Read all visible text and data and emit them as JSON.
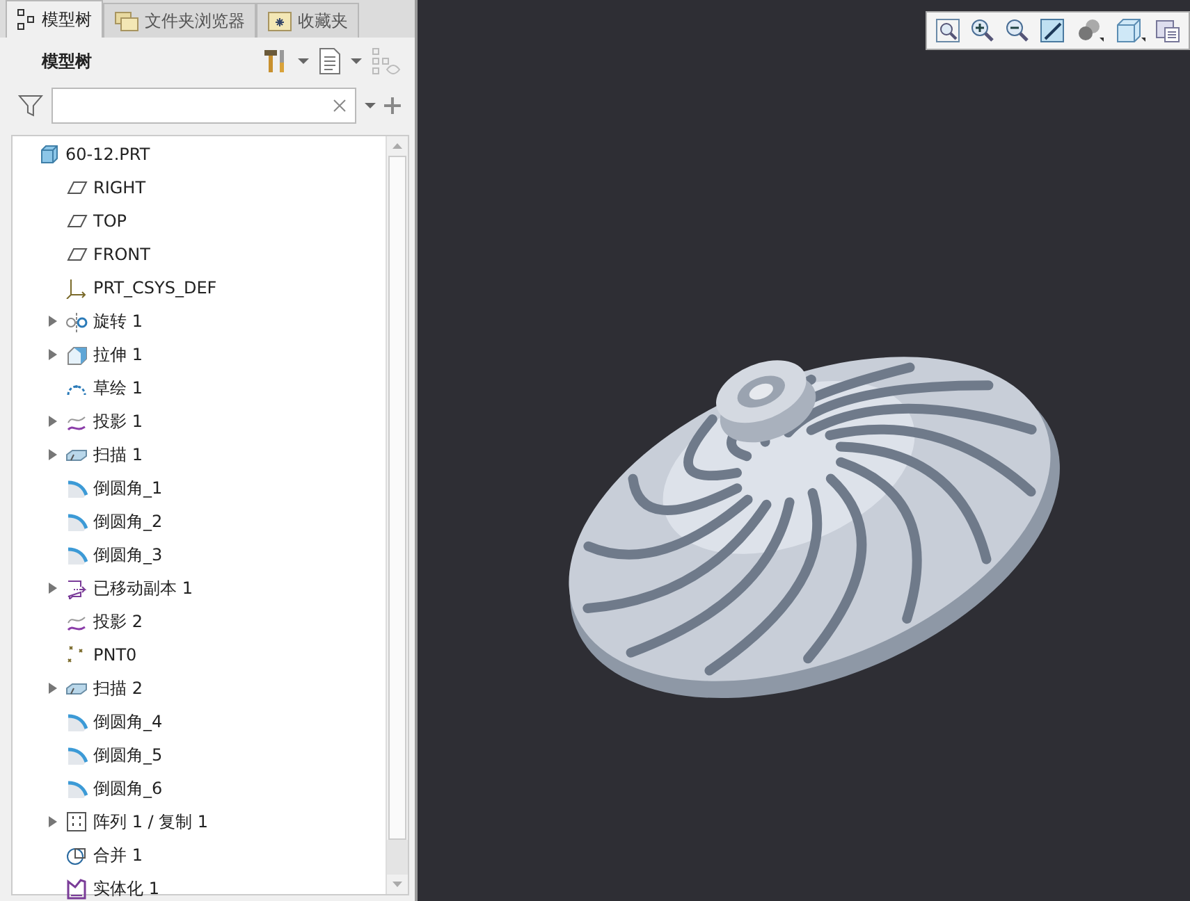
{
  "tabs": [
    {
      "label": "模型树",
      "kind": "tree",
      "selected": true
    },
    {
      "label": "文件夹浏览器",
      "kind": "folders",
      "selected": false
    },
    {
      "label": "收藏夹",
      "kind": "favorites",
      "selected": false
    }
  ],
  "panel_title": "模型树",
  "tree": {
    "label": "60-12.PRT",
    "kind": "part",
    "children": [
      {
        "label": "RIGHT",
        "kind": "plane",
        "expandable": false
      },
      {
        "label": "TOP",
        "kind": "plane",
        "expandable": false
      },
      {
        "label": "FRONT",
        "kind": "plane",
        "expandable": false
      },
      {
        "label": "PRT_CSYS_DEF",
        "kind": "csys",
        "expandable": false
      },
      {
        "label": "旋转 1",
        "kind": "revolve",
        "expandable": true
      },
      {
        "label": "拉伸 1",
        "kind": "extrude",
        "expandable": true
      },
      {
        "label": "草绘 1",
        "kind": "sketch",
        "expandable": false
      },
      {
        "label": "投影 1",
        "kind": "project",
        "expandable": true
      },
      {
        "label": "扫描 1",
        "kind": "sweep",
        "expandable": true
      },
      {
        "label": "倒圆角_1",
        "kind": "round",
        "expandable": false
      },
      {
        "label": "倒圆角_2",
        "kind": "round",
        "expandable": false
      },
      {
        "label": "倒圆角_3",
        "kind": "round",
        "expandable": false
      },
      {
        "label": "已移动副本 1",
        "kind": "moved",
        "expandable": true
      },
      {
        "label": "投影 2",
        "kind": "project",
        "expandable": false
      },
      {
        "label": "PNT0",
        "kind": "point",
        "expandable": false
      },
      {
        "label": "扫描 2",
        "kind": "sweep",
        "expandable": true
      },
      {
        "label": "倒圆角_4",
        "kind": "round",
        "expandable": false
      },
      {
        "label": "倒圆角_5",
        "kind": "round",
        "expandable": false
      },
      {
        "label": "倒圆角_6",
        "kind": "round",
        "expandable": false
      },
      {
        "label": "阵列 1 / 复制 1",
        "kind": "pattern",
        "expandable": true
      },
      {
        "label": "合并 1",
        "kind": "merge",
        "expandable": false
      },
      {
        "label": "实体化 1",
        "kind": "solidify",
        "expandable": false
      }
    ]
  }
}
